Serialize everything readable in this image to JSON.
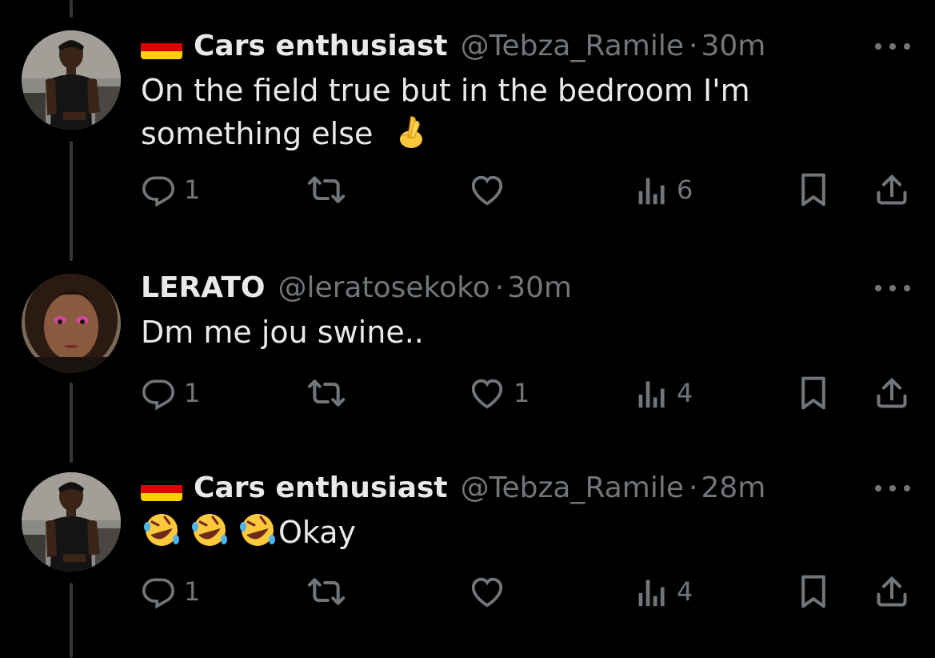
{
  "colors": {
    "background": "#000000",
    "text": "#e7e9ea",
    "muted": "#71767b",
    "thread_line": "#333639"
  },
  "tweets": [
    {
      "flag": "germany-flag",
      "name": "Cars enthusiast",
      "handle": "@Tebza_Ramile",
      "separator": "·",
      "time": "30m",
      "text_lines": [
        "On the field true but in the bedroom I'm",
        "something else"
      ],
      "emoji": "crossed-fingers",
      "replies": "1",
      "retweets": "",
      "likes": "",
      "views": "6"
    },
    {
      "flag": "",
      "name": "LERATO",
      "handle": "@leratosekoko",
      "separator": "·",
      "time": "30m",
      "text_lines": [
        "Dm me jou swine.."
      ],
      "replies": "1",
      "retweets": "",
      "likes": "1",
      "views": "4"
    },
    {
      "flag": "germany-flag",
      "name": "Cars enthusiast",
      "handle": "@Tebza_Ramile",
      "separator": "·",
      "time": "28m",
      "text_lines": [
        "Okay"
      ],
      "emoji": "rolling-on-floor-laughing x3",
      "replies": "1",
      "retweets": "",
      "likes": "",
      "views": "4"
    }
  ]
}
